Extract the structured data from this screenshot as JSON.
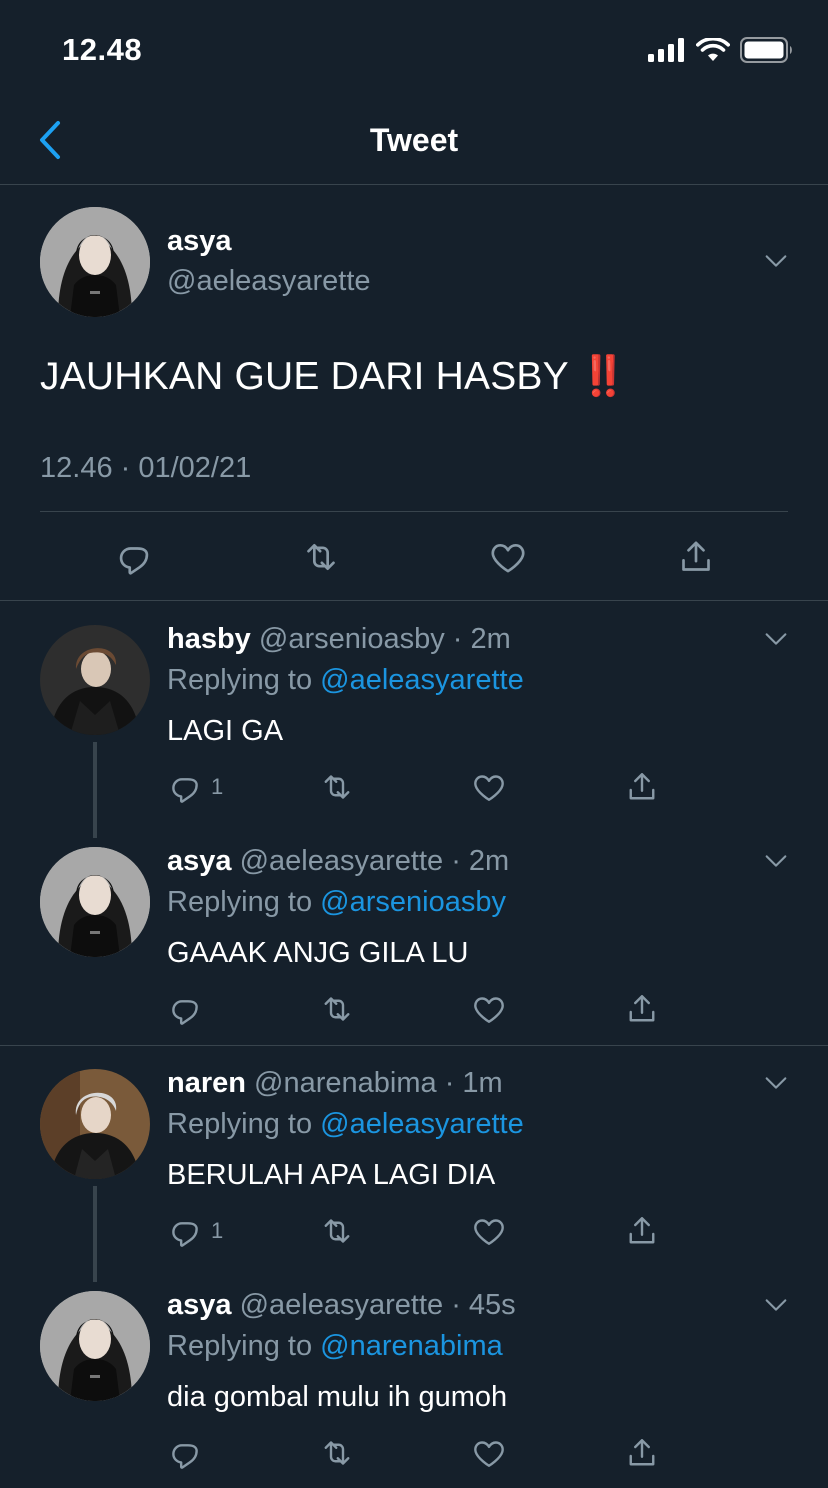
{
  "status_bar": {
    "time": "12.48"
  },
  "nav": {
    "title": "Tweet"
  },
  "main_tweet": {
    "name": "asya",
    "handle": "@aeleasyarette",
    "text": "JAUHKAN GUE DARI HASBY",
    "emoji": "‼️",
    "timestamp": "12.46 · 01/02/21"
  },
  "replies": [
    {
      "name": "hasby",
      "handle": "@arsenioasby",
      "time": "· 2m",
      "replying_prefix": "Replying to",
      "replying_to": "@aeleasyarette",
      "text": "LAGI GA",
      "reply_count": "1"
    },
    {
      "name": "asya",
      "handle": "@aeleasyarette",
      "time": "· 2m",
      "replying_prefix": "Replying to",
      "replying_to": "@arsenioasby",
      "text": "GAAAK ANJG GILA LU",
      "reply_count": ""
    },
    {
      "name": "naren",
      "handle": "@narenabima",
      "time": "· 1m",
      "replying_prefix": "Replying to",
      "replying_to": "@aeleasyarette",
      "text": "BERULAH APA LAGI DIA",
      "reply_count": "1"
    },
    {
      "name": "asya",
      "handle": "@aeleasyarette",
      "time": "· 45s",
      "replying_prefix": "Replying to",
      "replying_to": "@narenabima",
      "text": "dia gombal mulu ih gumoh",
      "reply_count": ""
    }
  ],
  "colors": {
    "background": "#15202b",
    "border": "#38444d",
    "secondary_text": "#8899a6",
    "link": "#1b95e0",
    "accent": "#1da1f2"
  },
  "icons": [
    "back-chevron-icon",
    "caret-down-icon",
    "reply-icon",
    "retweet-icon",
    "like-icon",
    "share-icon",
    "signal-icon",
    "wifi-icon",
    "battery-icon"
  ]
}
